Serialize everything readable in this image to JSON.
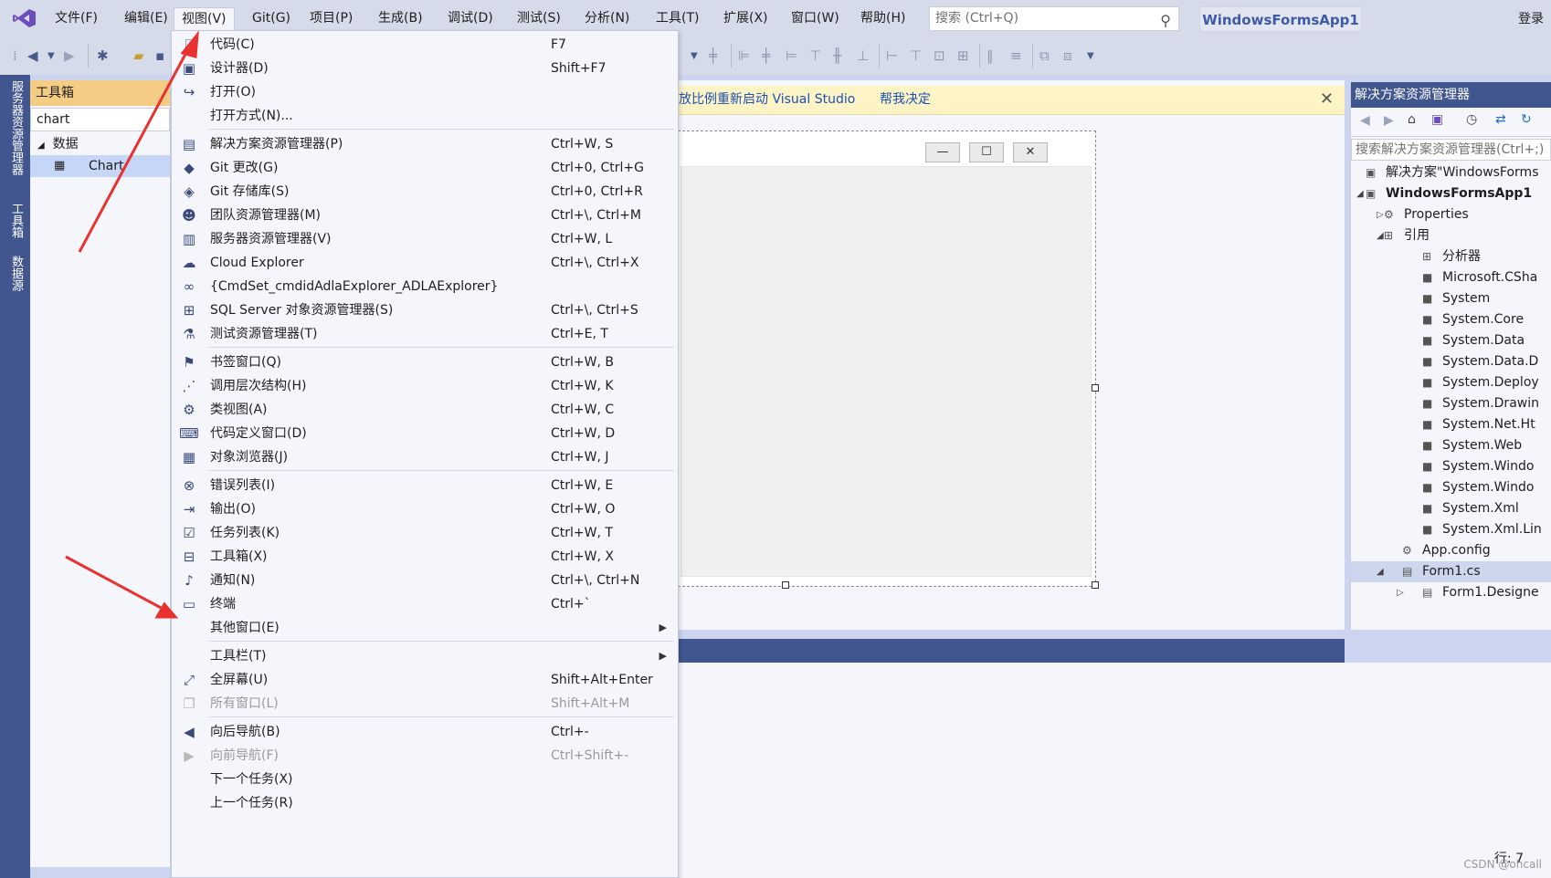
{
  "menubar": {
    "items": [
      "文件(F)",
      "编辑(E)",
      "视图(V)",
      "Git(G)",
      "项目(P)",
      "生成(B)",
      "调试(D)",
      "测试(S)",
      "分析(N)",
      "工具(T)",
      "扩展(X)",
      "窗口(W)",
      "帮助(H)"
    ],
    "search_placeholder": "搜索 (Ctrl+Q)",
    "project_name": "WindowsFormsApp1",
    "signin": "登录"
  },
  "left_strip": {
    "tab1": "服务器资源管理器",
    "tab2": "工具箱",
    "tab3": "数据源"
  },
  "toolbox": {
    "title": "工具箱",
    "search_value": "chart",
    "group": "数据",
    "item": "Chart"
  },
  "infobar": {
    "text": "放比例重新启动 Visual Studio",
    "link": "帮我决定",
    "close": "✕"
  },
  "solution": {
    "title": "解决方案资源管理器",
    "search": "搜索解决方案资源管理器(Ctrl+;)",
    "rows": [
      {
        "label": "解决方案\"WindowsForms",
        "bold": false
      },
      {
        "label": "WindowsFormsApp1",
        "bold": true
      },
      {
        "label": "Properties",
        "bold": false
      },
      {
        "label": "引用",
        "bold": false
      },
      {
        "label": "分析器",
        "bold": false
      },
      {
        "label": "Microsoft.CSha",
        "bold": false
      },
      {
        "label": "System",
        "bold": false
      },
      {
        "label": "System.Core",
        "bold": false
      },
      {
        "label": "System.Data",
        "bold": false
      },
      {
        "label": "System.Data.D",
        "bold": false
      },
      {
        "label": "System.Deploy",
        "bold": false
      },
      {
        "label": "System.Drawin",
        "bold": false
      },
      {
        "label": "System.Net.Ht",
        "bold": false
      },
      {
        "label": "System.Web",
        "bold": false
      },
      {
        "label": "System.Windo",
        "bold": false
      },
      {
        "label": "System.Windo",
        "bold": false
      },
      {
        "label": "System.Xml",
        "bold": false
      },
      {
        "label": "System.Xml.Lin",
        "bold": false
      },
      {
        "label": "App.config",
        "bold": false
      },
      {
        "label": "Form1.cs",
        "bold": false
      },
      {
        "label": "Form1.Designe",
        "bold": false
      }
    ]
  },
  "status": {
    "line": "行: 7",
    "watermark": "CSDN @ohcall"
  },
  "view_menu": {
    "items": [
      {
        "icon": "code-icon",
        "label": "代码(C)",
        "shortcut": "F7"
      },
      {
        "icon": "designer-icon",
        "label": "设计器(D)",
        "shortcut": "Shift+F7"
      },
      {
        "icon": "open-icon",
        "label": "打开(O)",
        "shortcut": ""
      },
      {
        "icon": "",
        "label": "打开方式(N)...",
        "shortcut": ""
      },
      {
        "sep": true
      },
      {
        "icon": "solution-explorer-icon",
        "label": "解决方案资源管理器(P)",
        "shortcut": "Ctrl+W, S"
      },
      {
        "icon": "git-changes-icon",
        "label": "Git 更改(G)",
        "shortcut": "Ctrl+0, Ctrl+G"
      },
      {
        "icon": "git-repo-icon",
        "label": "Git 存储库(S)",
        "shortcut": "Ctrl+0, Ctrl+R"
      },
      {
        "icon": "team-explorer-icon",
        "label": "团队资源管理器(M)",
        "shortcut": "Ctrl+\\, Ctrl+M"
      },
      {
        "icon": "server-explorer-icon",
        "label": "服务器资源管理器(V)",
        "shortcut": "Ctrl+W, L"
      },
      {
        "icon": "cloud-icon",
        "label": "Cloud Explorer",
        "shortcut": "Ctrl+\\, Ctrl+X"
      },
      {
        "icon": "binoculars-icon",
        "label": "{CmdSet_cmdidAdlaExplorer_ADLAExplorer}",
        "shortcut": ""
      },
      {
        "icon": "sql-server-icon",
        "label": "SQL Server 对象资源管理器(S)",
        "shortcut": "Ctrl+\\, Ctrl+S"
      },
      {
        "icon": "test-explorer-icon",
        "label": "测试资源管理器(T)",
        "shortcut": "Ctrl+E, T"
      },
      {
        "sep": true
      },
      {
        "icon": "bookmark-icon",
        "label": "书签窗口(Q)",
        "shortcut": "Ctrl+W, B"
      },
      {
        "icon": "call-hierarchy-icon",
        "label": "调用层次结构(H)",
        "shortcut": "Ctrl+W, K"
      },
      {
        "icon": "class-view-icon",
        "label": "类视图(A)",
        "shortcut": "Ctrl+W, C"
      },
      {
        "icon": "code-definition-icon",
        "label": "代码定义窗口(D)",
        "shortcut": "Ctrl+W, D"
      },
      {
        "icon": "object-browser-icon",
        "label": "对象浏览器(J)",
        "shortcut": "Ctrl+W, J"
      },
      {
        "sep": true
      },
      {
        "icon": "error-list-icon",
        "label": "错误列表(I)",
        "shortcut": "Ctrl+W, E"
      },
      {
        "icon": "output-icon",
        "label": "输出(O)",
        "shortcut": "Ctrl+W, O"
      },
      {
        "icon": "task-list-icon",
        "label": "任务列表(K)",
        "shortcut": "Ctrl+W, T"
      },
      {
        "icon": "toolbox-icon",
        "label": "工具箱(X)",
        "shortcut": "Ctrl+W, X"
      },
      {
        "icon": "bell-icon",
        "label": "通知(N)",
        "shortcut": "Ctrl+\\, Ctrl+N"
      },
      {
        "icon": "terminal-icon",
        "label": "终端",
        "shortcut": "Ctrl+`"
      },
      {
        "icon": "",
        "label": "其他窗口(E)",
        "shortcut": "",
        "submenu": true
      },
      {
        "sep": true
      },
      {
        "icon": "",
        "label": "工具栏(T)",
        "shortcut": "",
        "submenu": true
      },
      {
        "icon": "fullscreen-icon",
        "label": "全屏幕(U)",
        "shortcut": "Shift+Alt+Enter"
      },
      {
        "icon": "all-windows-icon",
        "label": "所有窗口(L)",
        "shortcut": "Shift+Alt+M",
        "disabled": true
      },
      {
        "sep": true
      },
      {
        "icon": "navigate-back-icon",
        "label": "向后导航(B)",
        "shortcut": "Ctrl+-"
      },
      {
        "icon": "navigate-forward-icon",
        "label": "向前导航(F)",
        "shortcut": "Ctrl+Shift+-",
        "disabled": true
      },
      {
        "icon": "",
        "label": "下一个任务(X)",
        "shortcut": ""
      },
      {
        "icon": "",
        "label": "上一个任务(R)",
        "shortcut": ""
      }
    ]
  }
}
